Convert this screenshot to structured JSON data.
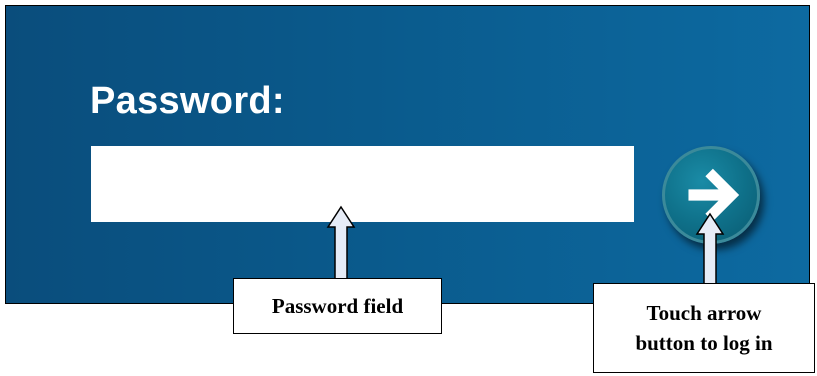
{
  "login": {
    "password_label": "Password:",
    "password_value": "",
    "login_button_icon": "right-arrow-icon"
  },
  "annotations": {
    "password_field": "Password field",
    "login_arrow": "Touch arrow\nbutton to log in"
  },
  "colors": {
    "background": "#0a5a8c",
    "button_fill": "#0e6f88",
    "field": "#ffffff",
    "callout_arrow": "#e6ecf7"
  }
}
